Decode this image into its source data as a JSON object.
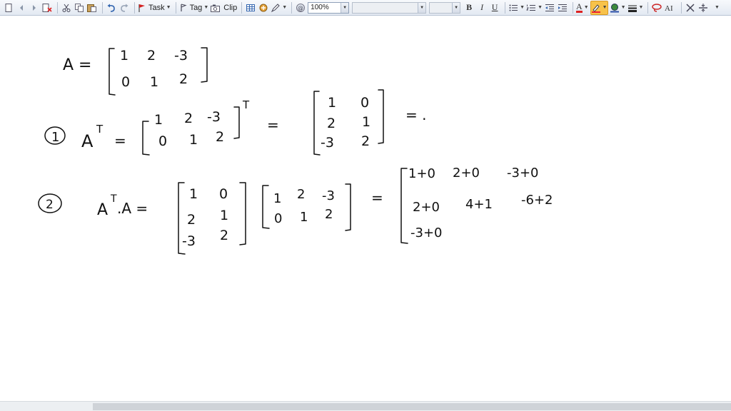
{
  "toolbar": {
    "task_label": "Task",
    "tag_label": "Tag",
    "clip_label": "Clip",
    "zoom_value": "100%",
    "font_family_value": "",
    "font_size_value": "",
    "bold_label": "B",
    "italic_label": "I",
    "underline_label": "U",
    "font_color_label": "A",
    "highlight_color": "#f7c24a",
    "icons": [
      "new-page-icon",
      "back-icon",
      "forward-icon",
      "delete-page-icon",
      "cut-icon",
      "copy-icon",
      "paste-icon",
      "undo-icon",
      "redo-icon",
      "flag-icon",
      "tag-icon",
      "camera-icon",
      "table-icon",
      "insert-icon",
      "pen-icon",
      "at-icon",
      "bullet-list-icon",
      "number-list-icon",
      "outdent-icon",
      "indent-icon",
      "font-color-icon",
      "highlighter-icon",
      "pen-color-icon",
      "line-weight-icon",
      "lasso-icon",
      "text-mode-icon",
      "eraser-icon",
      "space-icon"
    ]
  },
  "notes": {
    "line1": {
      "lhs": "A =",
      "matrix": [
        [
          "1",
          "2",
          "-3"
        ],
        [
          "0",
          "1",
          "2"
        ]
      ]
    },
    "line2": {
      "marker": "1",
      "lhs": "A",
      "lhs_sup": "T",
      "eq": "=",
      "matrix": [
        [
          "1",
          "2",
          "-3"
        ],
        [
          "0",
          "1",
          "2"
        ]
      ],
      "sup": "T",
      "eq2": "=",
      "result": [
        [
          "1",
          "0"
        ],
        [
          "2",
          "1"
        ],
        [
          "-3",
          "2"
        ]
      ],
      "eq3": "= ."
    },
    "line3": {
      "marker": "2",
      "lhs": "A",
      "lhs_sup": "T",
      "lhs2": ".A =",
      "m1": [
        [
          "1",
          "0"
        ],
        [
          "2",
          "1"
        ],
        [
          "-3",
          "2"
        ]
      ],
      "m2": [
        [
          "1",
          "2",
          "-3"
        ],
        [
          "0",
          "1",
          "2"
        ]
      ],
      "eq": "=",
      "result": [
        [
          "1+0",
          "2+0",
          "-3+0"
        ],
        [
          "2+0",
          "4+1",
          "-6+2"
        ],
        [
          "-3+0"
        ]
      ]
    }
  }
}
